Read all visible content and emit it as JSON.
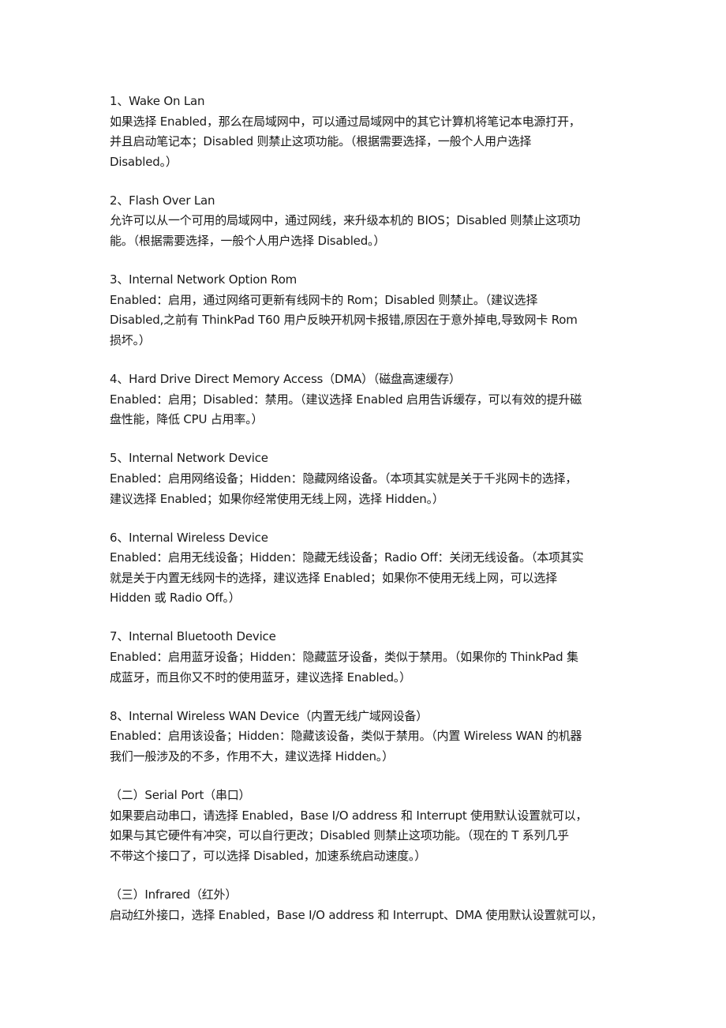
{
  "document": {
    "sections": [
      {
        "heading": "1、Wake On Lan",
        "lines": [
          "如果选择 Enabled，那么在局域网中，可以通过局域网中的其它计算机将笔记本电源打开，",
          "并且启动笔记本；Disabled 则禁止这项功能。（根据需要选择，一般个人用户选择",
          "Disabled。）"
        ]
      },
      {
        "heading": "2、Flash Over Lan",
        "lines": [
          "允许可以从一个可用的局域网中，通过网线，来升级本机的 BIOS；Disabled 则禁止这项功",
          "能。（根据需要选择，一般个人用户选择 Disabled。）"
        ]
      },
      {
        "heading": "3、Internal Network Option Rom",
        "lines": [
          "Enabled：启用，通过网络可更新有线网卡的 Rom；Disabled 则禁止。（建议选择",
          "Disabled,之前有 ThinkPad T60 用户反映开机网卡报错,原因在于意外掉电,导致网卡 Rom",
          "损坏。）"
        ]
      },
      {
        "heading": "4、Hard Drive Direct Memory Access（DMA）（磁盘高速缓存）",
        "lines": [
          "Enabled：启用；Disabled：禁用。（建议选择 Enabled 启用告诉缓存，可以有效的提升磁",
          "盘性能，降低 CPU 占用率。）"
        ]
      },
      {
        "heading": "5、Internal Network Device",
        "lines": [
          "Enabled：启用网络设备；Hidden：隐藏网络设备。（本项其实就是关于千兆网卡的选择，",
          "建议选择 Enabled；如果你经常使用无线上网，选择 Hidden。）"
        ]
      },
      {
        "heading": "6、Internal Wireless Device",
        "lines": [
          "Enabled：启用无线设备；Hidden：隐藏无线设备；Radio Off：关闭无线设备。（本项其实",
          "就是关于内置无线网卡的选择，建议选择 Enabled；如果你不使用无线上网，可以选择",
          "Hidden 或 Radio Off。）"
        ]
      },
      {
        "heading": "7、Internal Bluetooth Device",
        "lines": [
          "Enabled：启用蓝牙设备；Hidden：隐藏蓝牙设备，类似于禁用。（如果你的 ThinkPad 集",
          "成蓝牙，而且你又不时的使用蓝牙，建议选择 Enabled。）"
        ]
      },
      {
        "heading": "8、Internal Wireless WAN Device（内置无线广域网设备）",
        "lines": [
          "Enabled：启用该设备；Hidden：隐藏该设备，类似于禁用。（内置 Wireless WAN 的机器",
          "我们一般涉及的不多，作用不大，建议选择 Hidden。）"
        ]
      },
      {
        "heading": "（二）Serial Port（串口）",
        "lines": [
          "如果要启动串口，请选择 Enabled，Base I/O address 和 Interrupt 使用默认设置就可以，",
          "如果与其它硬件有冲突，可以自行更改；Disabled 则禁止这项功能。（现在的 T 系列几乎",
          "不带这个接口了，可以选择 Disabled，加速系统启动速度。）"
        ]
      },
      {
        "heading": "（三）Infrared（红外）",
        "lines": [
          "启动红外接口，选择 Enabled，Base I/O address 和 Interrupt、DMA 使用默认设置就可以，"
        ]
      }
    ]
  }
}
